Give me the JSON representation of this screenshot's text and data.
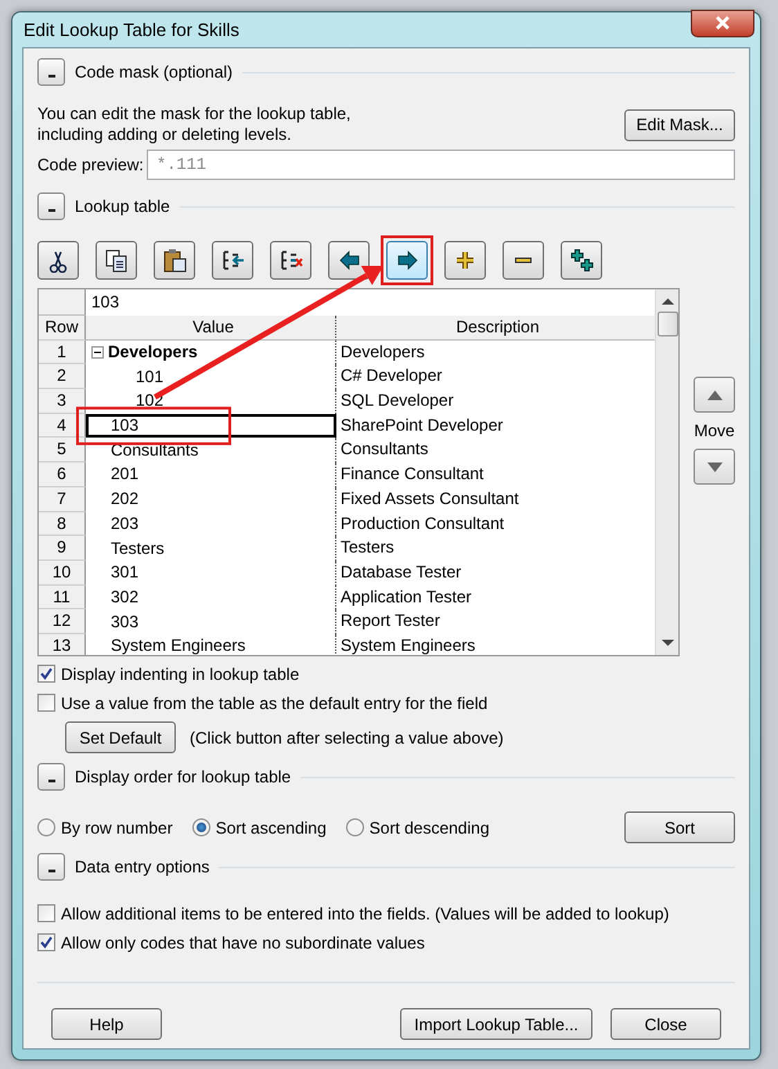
{
  "window": {
    "title": "Edit Lookup Table for Skills"
  },
  "code_mask": {
    "heading": "Code mask (optional)",
    "expanded": true,
    "info": "You can edit the mask for the lookup table, including adding or deleting levels.",
    "edit_button": "Edit Mask...",
    "preview_label": "Code preview:",
    "preview_value": "*.111"
  },
  "lookup_table": {
    "heading": "Lookup table",
    "expanded": true,
    "toolbar": [
      {
        "kind": "cut",
        "annotated": false
      },
      {
        "kind": "copy",
        "annotated": false
      },
      {
        "kind": "paste",
        "annotated": false
      },
      {
        "kind": "insert",
        "annotated": false
      },
      {
        "kind": "delete",
        "annotated": false
      },
      {
        "kind": "outdent",
        "annotated": false
      },
      {
        "kind": "indent",
        "annotated": true
      },
      {
        "kind": "plus",
        "annotated": false
      },
      {
        "kind": "minus",
        "annotated": false
      },
      {
        "kind": "plusplus",
        "annotated": false
      }
    ],
    "edit_value": "103",
    "columns": [
      "Row",
      "Value",
      "Description"
    ],
    "rows": [
      {
        "row": "1",
        "value": "Developers",
        "description": "Developers",
        "selected": false,
        "annotated": false,
        "expanded": true,
        "children": [
          {
            "row": "2",
            "value": "101",
            "description": "C# Developer",
            "selected": false,
            "annotated": false
          },
          {
            "row": "3",
            "value": "102",
            "description": "SQL Developer",
            "selected": false,
            "annotated": false
          }
        ]
      },
      {
        "row": "4",
        "value": "103",
        "description": "SharePoint Developer",
        "selected": true,
        "annotated": true
      },
      {
        "row": "5",
        "value": "Consultants",
        "description": "Consultants",
        "selected": false,
        "annotated": false
      },
      {
        "row": "6",
        "value": "201",
        "description": "Finance Consultant",
        "selected": false,
        "annotated": false
      },
      {
        "row": "7",
        "value": "202",
        "description": "Fixed Assets Consultant",
        "selected": false,
        "annotated": false
      },
      {
        "row": "8",
        "value": "203",
        "description": "Production Consultant",
        "selected": false,
        "annotated": false
      },
      {
        "row": "9",
        "value": "Testers",
        "description": "Testers",
        "selected": false,
        "annotated": false
      },
      {
        "row": "10",
        "value": "301",
        "description": "Database Tester",
        "selected": false,
        "annotated": false
      },
      {
        "row": "11",
        "value": "302",
        "description": "Application Tester",
        "selected": false,
        "annotated": false
      },
      {
        "row": "12",
        "value": "303",
        "description": "Report Tester",
        "selected": false,
        "annotated": false
      },
      {
        "row": "13",
        "value": "System Engineers",
        "description": "System Engineers",
        "selected": false,
        "annotated": false
      }
    ],
    "move_label": "Move",
    "options": [
      {
        "label": "Display indenting in lookup table",
        "checked": true
      },
      {
        "label": "Use a value from the table as the default entry for the field",
        "checked": false
      }
    ],
    "set_default_button": "Set Default",
    "set_default_hint": "(Click button after selecting a value above)"
  },
  "display_order": {
    "heading": "Display order for lookup table",
    "expanded": true,
    "choices": [
      {
        "label": "By row number",
        "selected": false
      },
      {
        "label": "Sort ascending",
        "selected": true
      },
      {
        "label": "Sort descending",
        "selected": false
      }
    ],
    "sort_button": "Sort"
  },
  "data_entry": {
    "heading": "Data entry options",
    "expanded": true,
    "options": [
      {
        "label": "Allow additional items to be entered into the fields. (Values will be added to lookup)",
        "checked": false
      },
      {
        "label": "Allow only codes that have no subordinate values",
        "checked": true
      }
    ]
  },
  "buttons": {
    "help": "Help",
    "import": "Import Lookup Table...",
    "close": "Close"
  }
}
